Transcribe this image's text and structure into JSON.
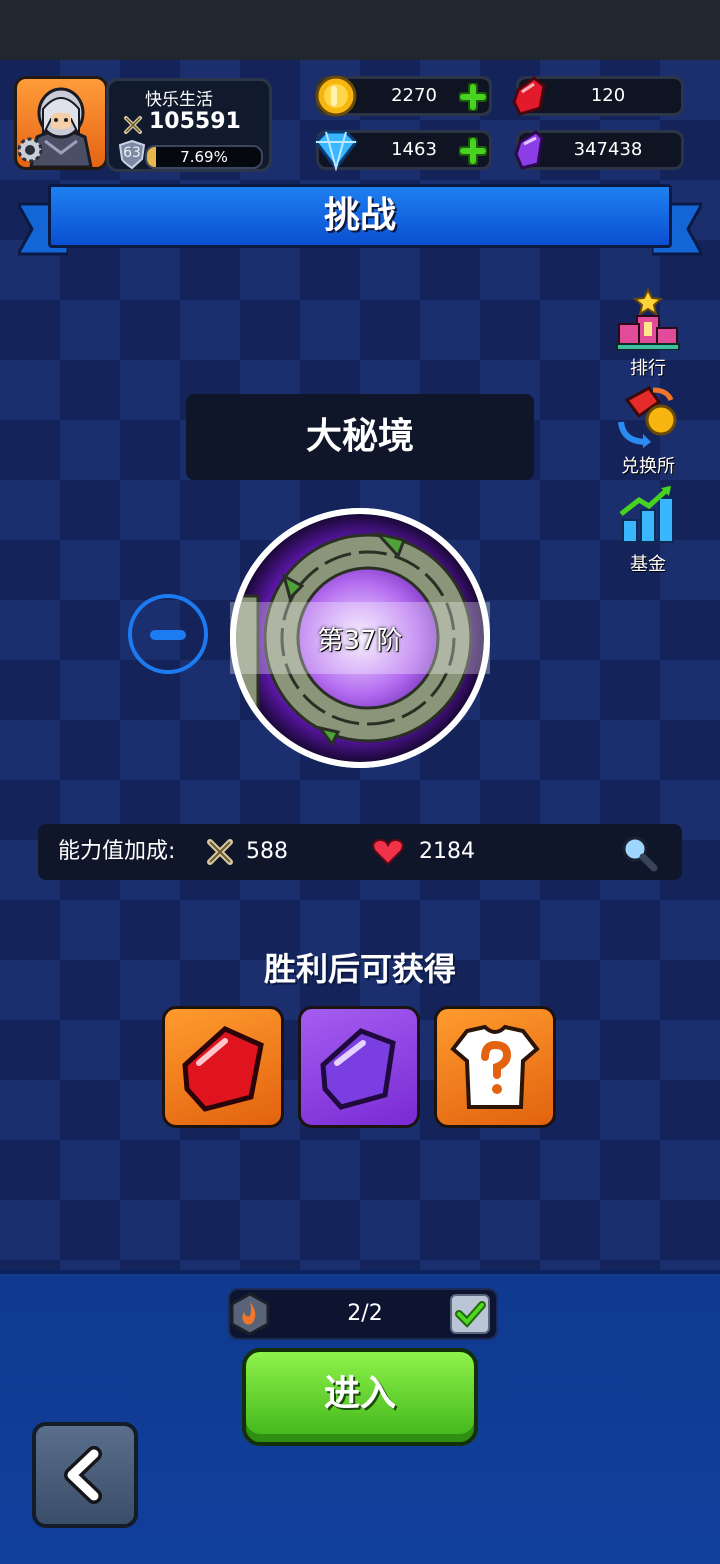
{
  "player": {
    "name": "快乐生活",
    "power": "105591",
    "level": "63",
    "xp_percent": "7.69%",
    "xp_fraction": 0.0769
  },
  "resources": {
    "gold": "2270",
    "diamond": "1463",
    "red_gem": "120",
    "purple_gem": "347438"
  },
  "header": {
    "title": "挑战"
  },
  "side_menu": [
    {
      "label": "排行",
      "icon": "podium-icon"
    },
    {
      "label": "兑换所",
      "icon": "exchange-icon"
    },
    {
      "label": "基金",
      "icon": "fund-chart-icon"
    }
  ],
  "stage": {
    "name": "大秘境",
    "level_label": "第37阶"
  },
  "bonus": {
    "label": "能力值加成:",
    "attack": "588",
    "hp": "2184"
  },
  "rewards": {
    "title": "胜利后可获得",
    "items": [
      "red-gem-icon",
      "purple-gem-icon",
      "mystery-armor-icon"
    ]
  },
  "ticket": {
    "count": "2/2"
  },
  "enter_button": {
    "label": "进入"
  },
  "colors": {
    "accent_blue": "#1d7bf2",
    "enter_green": "#5fd32a",
    "reward_orange": "#f08a22",
    "reward_purple": "#8a3de0"
  }
}
